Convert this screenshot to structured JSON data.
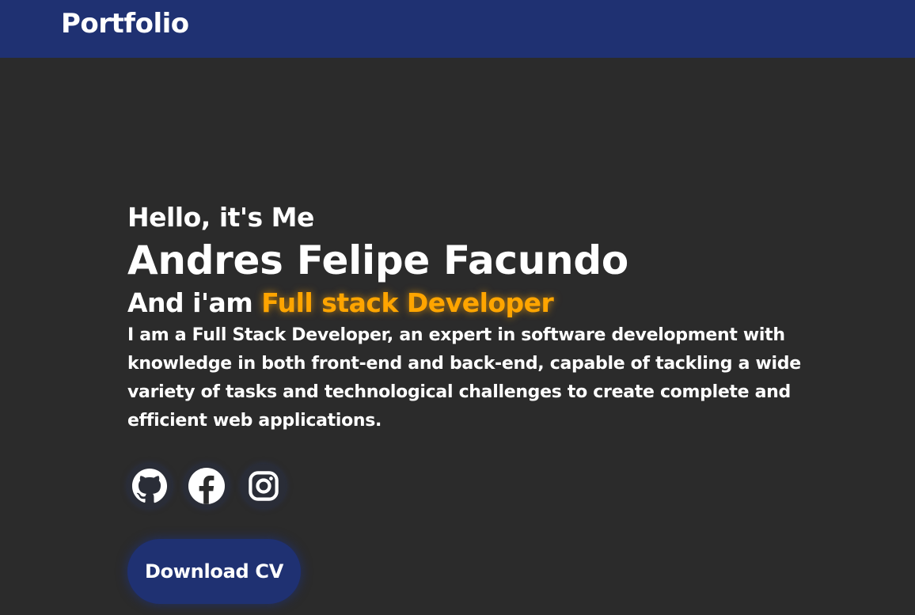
{
  "header": {
    "brand": "Portfolio"
  },
  "hero": {
    "greeting": "Hello, it's Me",
    "name": "Andres Felipe Facundo",
    "role_prefix": "And i'am",
    "role_highlight": "Full stack Developer",
    "description": "I am a Full Stack Developer, an expert in software development with knowledge in both front-end and back-end, capable of tackling a wide variety of tasks and technological challenges to create complete and efficient web applications."
  },
  "socials": [
    {
      "icon": "github-icon"
    },
    {
      "icon": "facebook-icon"
    },
    {
      "icon": "instagram-icon"
    }
  ],
  "cta": {
    "download_label": "Download CV"
  },
  "colors": {
    "header_bg": "#1f3172",
    "page_bg": "#2b2b2b",
    "accent": "#ffa500",
    "text": "#ffffff"
  }
}
